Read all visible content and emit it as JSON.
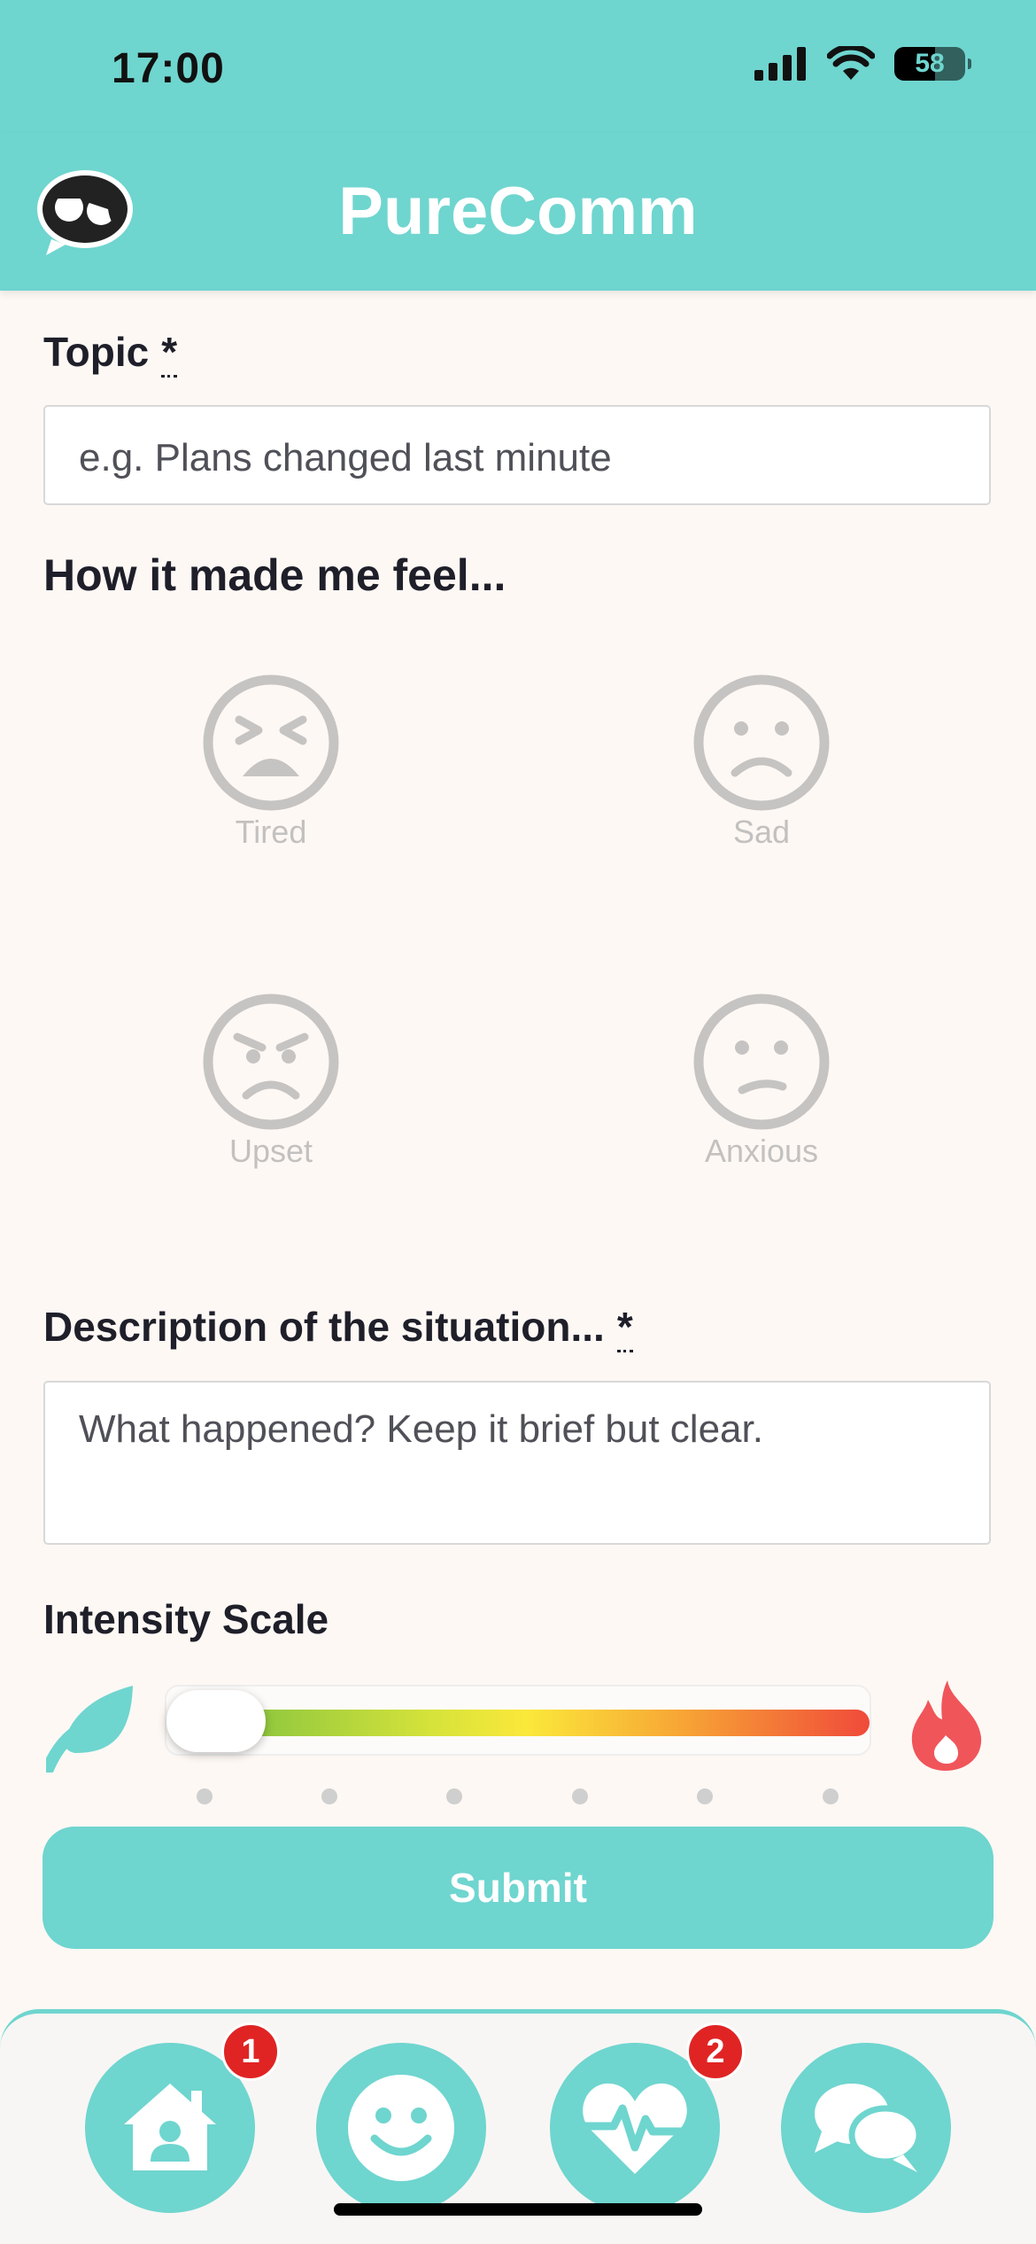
{
  "status": {
    "time": "17:00",
    "battery": "58"
  },
  "header": {
    "title": "PureComm"
  },
  "topic": {
    "label": "Topic",
    "required_mark": "*",
    "placeholder": "e.g. Plans changed last minute"
  },
  "feelings": {
    "label": "How it made me feel...",
    "options": [
      {
        "label": "Tired",
        "icon": "tired-face-icon"
      },
      {
        "label": "Sad",
        "icon": "sad-face-icon"
      },
      {
        "label": "Upset",
        "icon": "angry-face-icon"
      },
      {
        "label": "Anxious",
        "icon": "anxious-face-icon"
      }
    ]
  },
  "description": {
    "label": "Description of the situation...",
    "required_mark": "*",
    "placeholder": "What happened? Keep it brief but clear."
  },
  "intensity": {
    "label": "Intensity Scale",
    "value": 0,
    "steps": 6,
    "low_icon": "leaf-icon",
    "high_icon": "fire-icon"
  },
  "submit": {
    "label": "Submit"
  },
  "nav": {
    "items": [
      {
        "icon": "home-icon",
        "badge": "1"
      },
      {
        "icon": "smiley-icon",
        "badge": ""
      },
      {
        "icon": "heart-pulse-icon",
        "badge": "2"
      },
      {
        "icon": "chat-bubbles-icon",
        "badge": ""
      }
    ]
  },
  "colors": {
    "accent": "#6fd5cf",
    "badge": "#e02424",
    "fire": "#f0555a",
    "leaf": "#6fd5cf"
  }
}
